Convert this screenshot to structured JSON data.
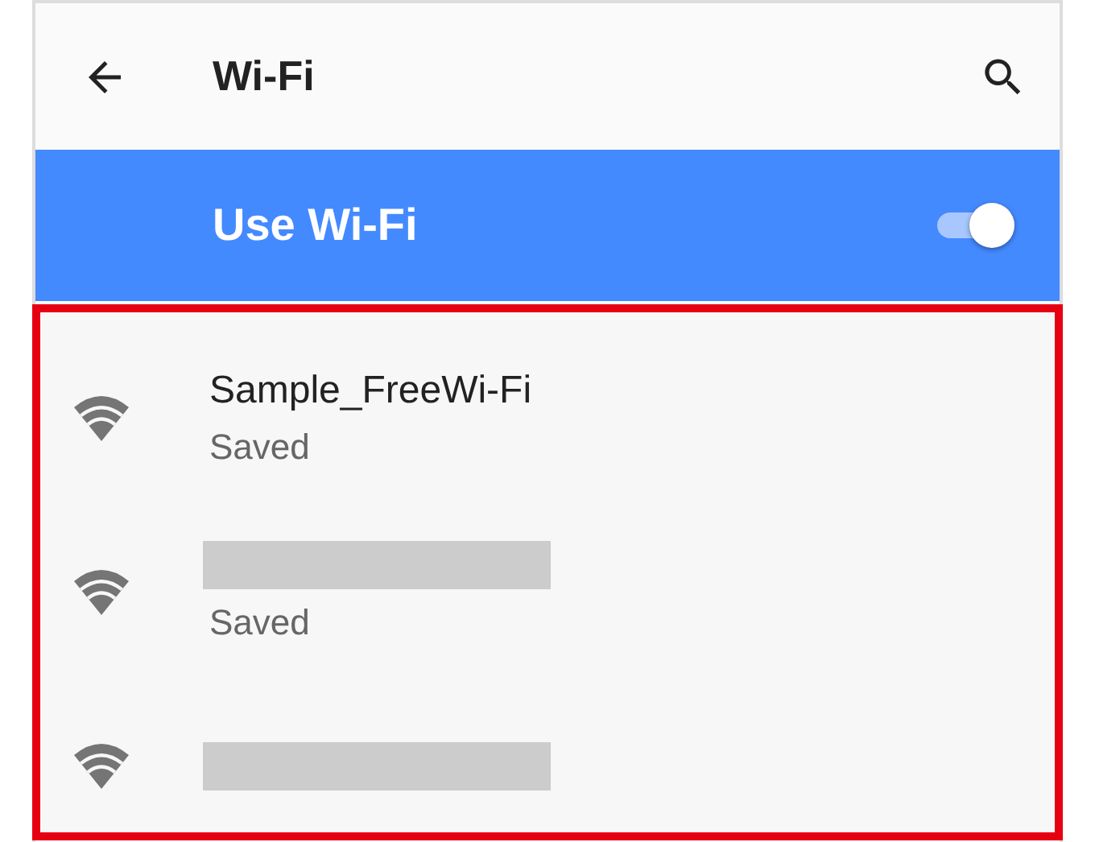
{
  "app_bar": {
    "title": "Wi-Fi"
  },
  "master_switch": {
    "label": "Use Wi-Fi",
    "on": true
  },
  "networks": [
    {
      "kind": "named",
      "name": "Sample_FreeWi-Fi",
      "status": "Saved"
    },
    {
      "kind": "redacted",
      "status": "Saved"
    },
    {
      "kind": "redacted"
    }
  ]
}
